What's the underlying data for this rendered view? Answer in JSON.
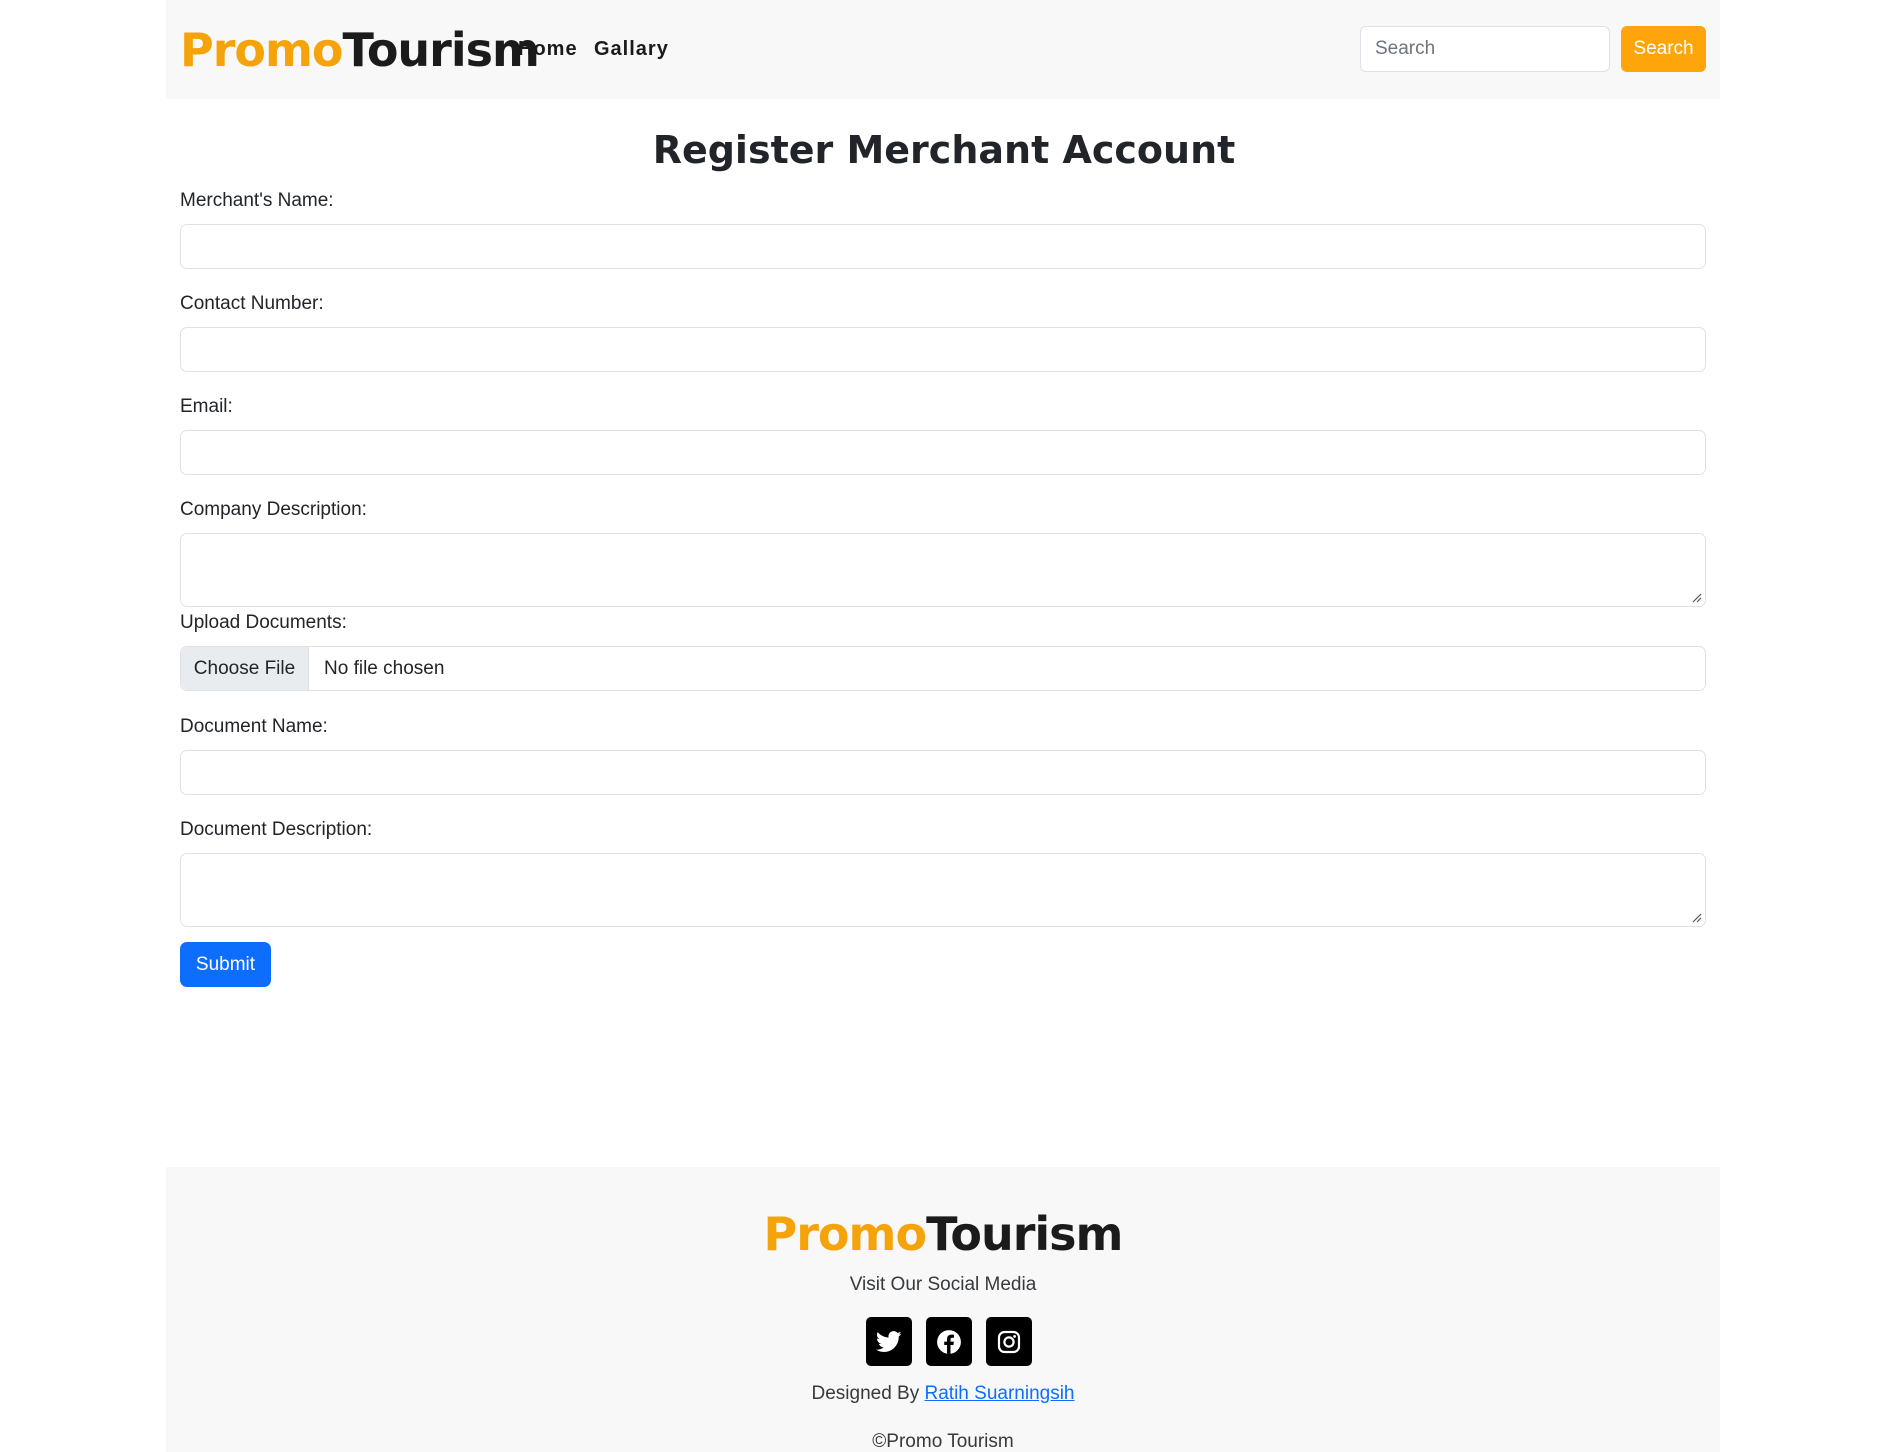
{
  "header": {
    "brand_part1": "Promo",
    "brand_part2": "Tourism",
    "nav": {
      "home": "Home",
      "gallery": "Gallary"
    },
    "search": {
      "placeholder": "Search",
      "button_label": "Search"
    }
  },
  "form": {
    "title": "Register Merchant Account",
    "merchant_name_label": "Merchant's Name:",
    "contact_number_label": "Contact Number:",
    "email_label": "Email:",
    "company_description_label": "Company Description:",
    "upload_documents_label": "Upload Documents:",
    "choose_file_label": "Choose File",
    "file_status": "No file chosen",
    "document_name_label": "Document Name:",
    "document_description_label": "Document Description:",
    "submit_label": "Submit"
  },
  "footer": {
    "brand_part1": "Promo",
    "brand_part2": "Tourism",
    "social_heading": "Visit Our Social Media",
    "socials": [
      "twitter-icon",
      "facebook-icon",
      "instagram-icon"
    ],
    "designed_by_prefix": "Designed By",
    "designer_name": "Ratih Suarningsih",
    "copyright": "©Promo Tourism"
  },
  "colors": {
    "brand_orange": "#f5a30b",
    "search_button": "#fea50c",
    "submit_button": "#0d6efd",
    "link": "#0d6efd"
  }
}
